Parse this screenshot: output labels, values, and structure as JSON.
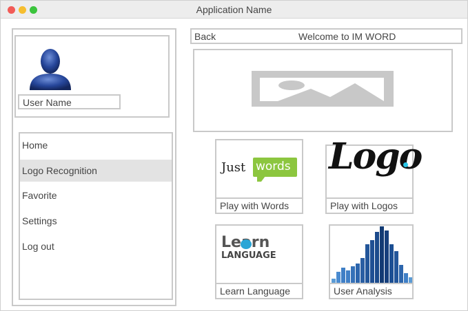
{
  "window": {
    "title": "Application Name"
  },
  "profile": {
    "username": "User Name"
  },
  "nav": {
    "items": [
      {
        "label": "Home"
      },
      {
        "label": "Logo Recognition"
      },
      {
        "label": "Favorite"
      },
      {
        "label": "Settings"
      },
      {
        "label": "Log out"
      }
    ]
  },
  "header": {
    "back_label": "Back",
    "title": "Welcome to IM WORD"
  },
  "tiles": [
    {
      "label": "Play with Words",
      "logo_text_1": "Just",
      "logo_text_2": "words"
    },
    {
      "label": "Play with Logos",
      "logo_text": "Logo"
    },
    {
      "label": "Learn Language",
      "logo_text_1": "Learn",
      "logo_text_2": "LANGUAGE"
    },
    {
      "label": "User Analysis"
    }
  ],
  "colors": {
    "close": "#f25b57",
    "minimize": "#f6be2f",
    "maximize": "#3bc43c",
    "accent_green": "#8cc63f",
    "chart_blue": "#1c4f93"
  }
}
